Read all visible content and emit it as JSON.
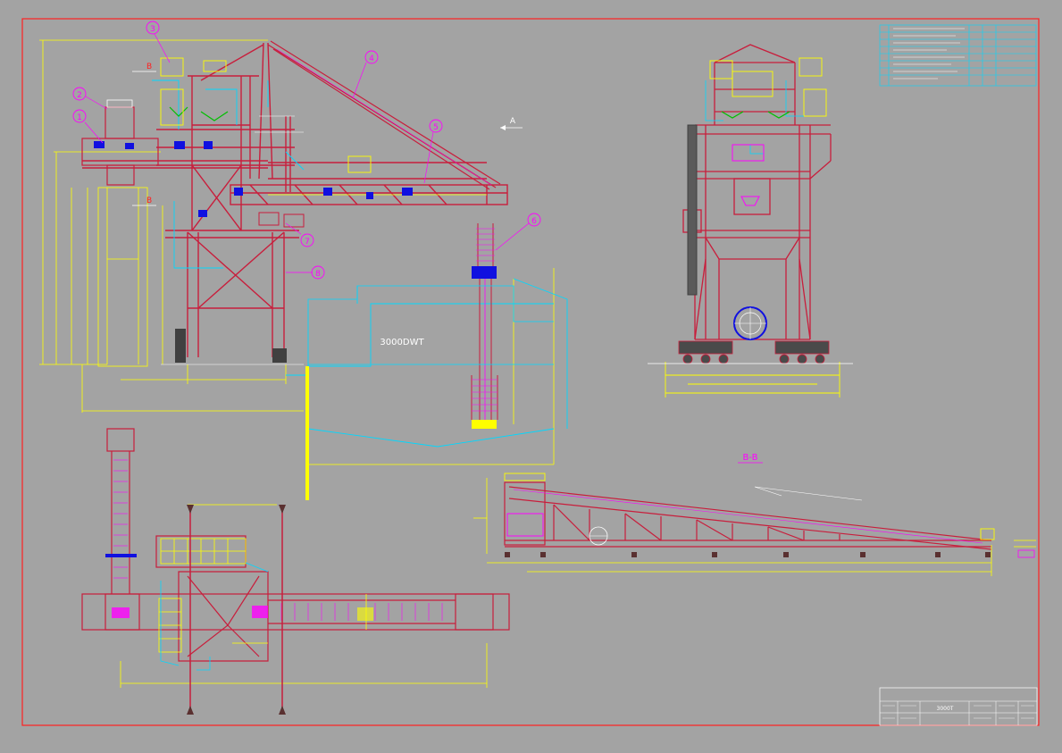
{
  "callouts": [
    {
      "num": "1"
    },
    {
      "num": "2"
    },
    {
      "num": "3"
    },
    {
      "num": "4"
    },
    {
      "num": "5"
    },
    {
      "num": "6"
    },
    {
      "num": "7"
    },
    {
      "num": "8"
    }
  ],
  "view_labels": {
    "section_a": "A",
    "section_b_top": "B",
    "section_b_bottom": "B",
    "section_bb_title": "B-B"
  },
  "ship_label": "3000DWT",
  "title_block": {
    "drawing_title": "3000T"
  },
  "colors": {
    "background": "#a3a3a3",
    "border": "#ff2020",
    "structure": "#c81e3c",
    "dimension": "#ffff00",
    "hydraulic": "#00d8ff",
    "equipment": "#ff00ff",
    "motor": "#1010e0",
    "annotation": "#ffffff"
  }
}
